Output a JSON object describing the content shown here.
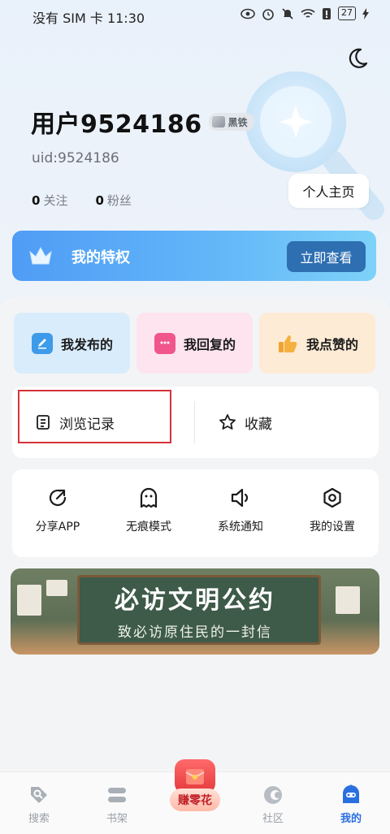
{
  "status_bar": {
    "left_text": "没有 SIM 卡 11:30",
    "battery": "27"
  },
  "profile": {
    "username": "用户9524186",
    "level_badge": "黑铁",
    "uid": "uid:9524186",
    "following_count": "0",
    "following_label": "关注",
    "fans_count": "0",
    "fans_label": "粉丝",
    "home_button": "个人主页"
  },
  "vip": {
    "title": "我的特权",
    "button": "立即查看"
  },
  "quick_actions": [
    {
      "label": "我发布的",
      "icon": "pencil-icon"
    },
    {
      "label": "我回复的",
      "icon": "chat-bubble-icon"
    },
    {
      "label": "我点赞的",
      "icon": "thumbs-up-icon"
    }
  ],
  "history": {
    "browse_label": "浏览记录",
    "favorites_label": "收藏"
  },
  "tools": [
    {
      "label": "分享APP",
      "icon": "share-icon"
    },
    {
      "label": "无痕模式",
      "icon": "ghost-icon"
    },
    {
      "label": "系统通知",
      "icon": "speaker-icon"
    },
    {
      "label": "我的设置",
      "icon": "settings-icon"
    }
  ],
  "banner": {
    "title": "必访文明公约",
    "subtitle": "致必访原住民的一封信"
  },
  "tabbar": {
    "tabs": [
      {
        "label": "搜索",
        "icon": "search-tag-icon"
      },
      {
        "label": "书架",
        "icon": "bookshelf-icon"
      },
      {
        "label": "赚零花",
        "icon": "red-envelope-icon"
      },
      {
        "label": "社区",
        "icon": "community-icon"
      },
      {
        "label": "我的",
        "icon": "profile-robot-icon"
      }
    ],
    "active": "我的"
  },
  "colors": {
    "accent": "#2a6fe0",
    "vip_gradient_start": "#4f9cf6",
    "highlight": "#d6323a"
  }
}
